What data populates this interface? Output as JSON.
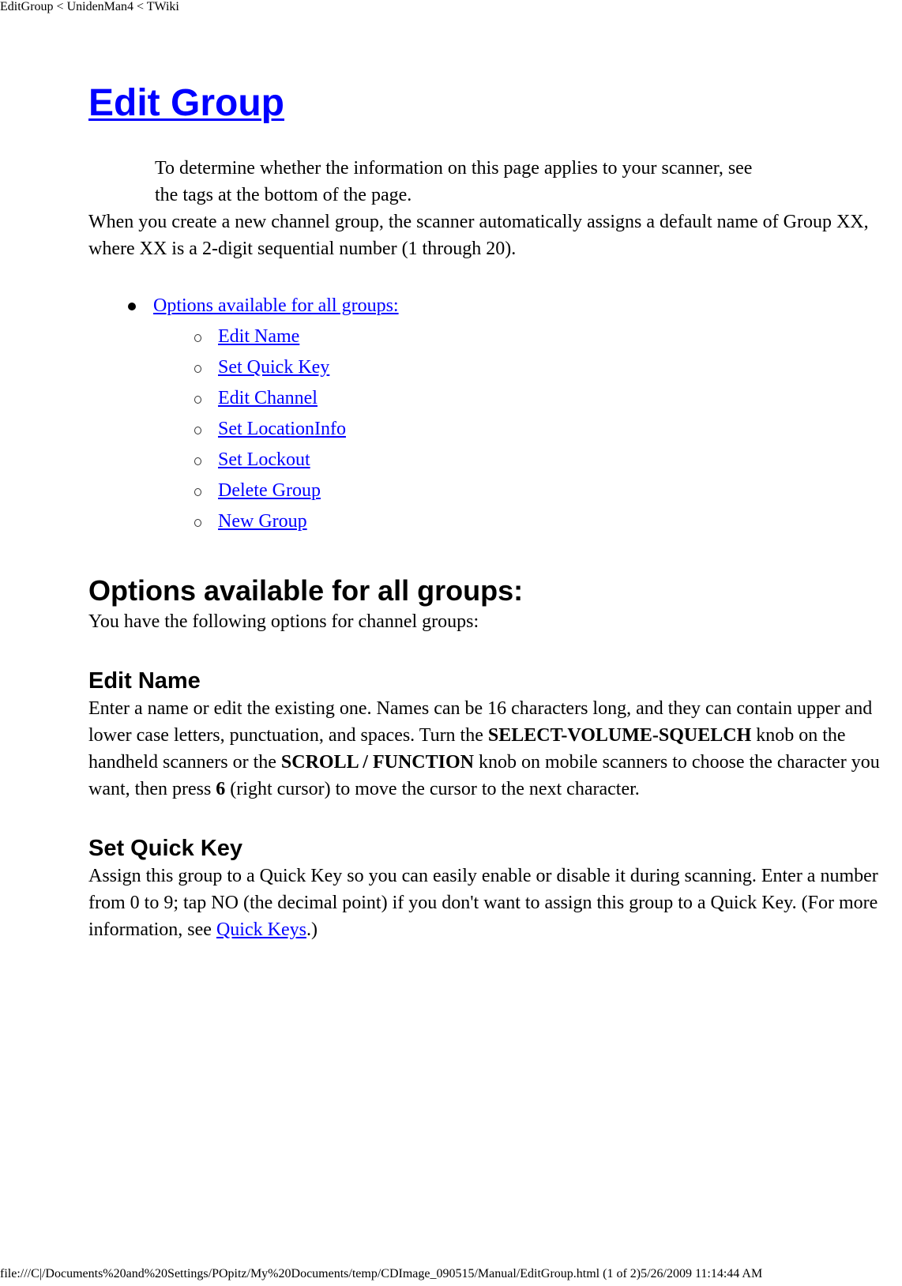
{
  "print_header": {
    "title": "EditGroup < UnidenMan4 < TWiki"
  },
  "page": {
    "title": "Edit Group",
    "intro_note": "To determine whether the information on this page applies to your scanner, see the tags at the bottom of the page.",
    "default_name_text": "When you create a new channel group, the scanner automatically assigns a default name of Group XX, where XX is a 2-digit sequential number (1 through 20)."
  },
  "toc": {
    "top_item": "Options available for all groups:",
    "sub_items": [
      {
        "label": "Edit Name"
      },
      {
        "label": "Set Quick Key"
      },
      {
        "label": "Edit Channel"
      },
      {
        "label": "Set LocationInfo"
      },
      {
        "label": "Set Lockout"
      },
      {
        "label": "Delete Group"
      },
      {
        "label": "New Group"
      }
    ]
  },
  "options_section": {
    "heading": "Options available for all groups:",
    "intro": "You have the following options for channel groups:"
  },
  "edit_name": {
    "heading": "Edit Name",
    "text_1": "Enter a name or edit the existing one. Names can be 16 characters long, and they can contain upper and lower case letters, punctuation, and spaces. Turn the ",
    "bold_1": "SELECT-VOLUME-SQUELCH",
    "text_2": " knob on the handheld scanners or the ",
    "bold_2": "SCROLL / FUNCTION",
    "text_3": " knob on mobile scanners to choose the character you want, then press ",
    "bold_3": "6",
    "text_4": " (right cursor) to move the cursor to the next character."
  },
  "set_quick_key": {
    "heading": "Set Quick Key",
    "text_1": "Assign this group to a Quick Key so you can easily enable or disable it during scanning. Enter a number from 0 to 9; tap NO (the decimal point) if you don't want to assign this group to a Quick Key. (For more information, see ",
    "link": "Quick Keys",
    "text_2": ".)"
  },
  "print_footer": {
    "text": "file:///C|/Documents%20and%20Settings/POpitz/My%20Documents/temp/CDImage_090515/Manual/EditGroup.html (1 of 2)5/26/2009 11:14:44 AM"
  }
}
